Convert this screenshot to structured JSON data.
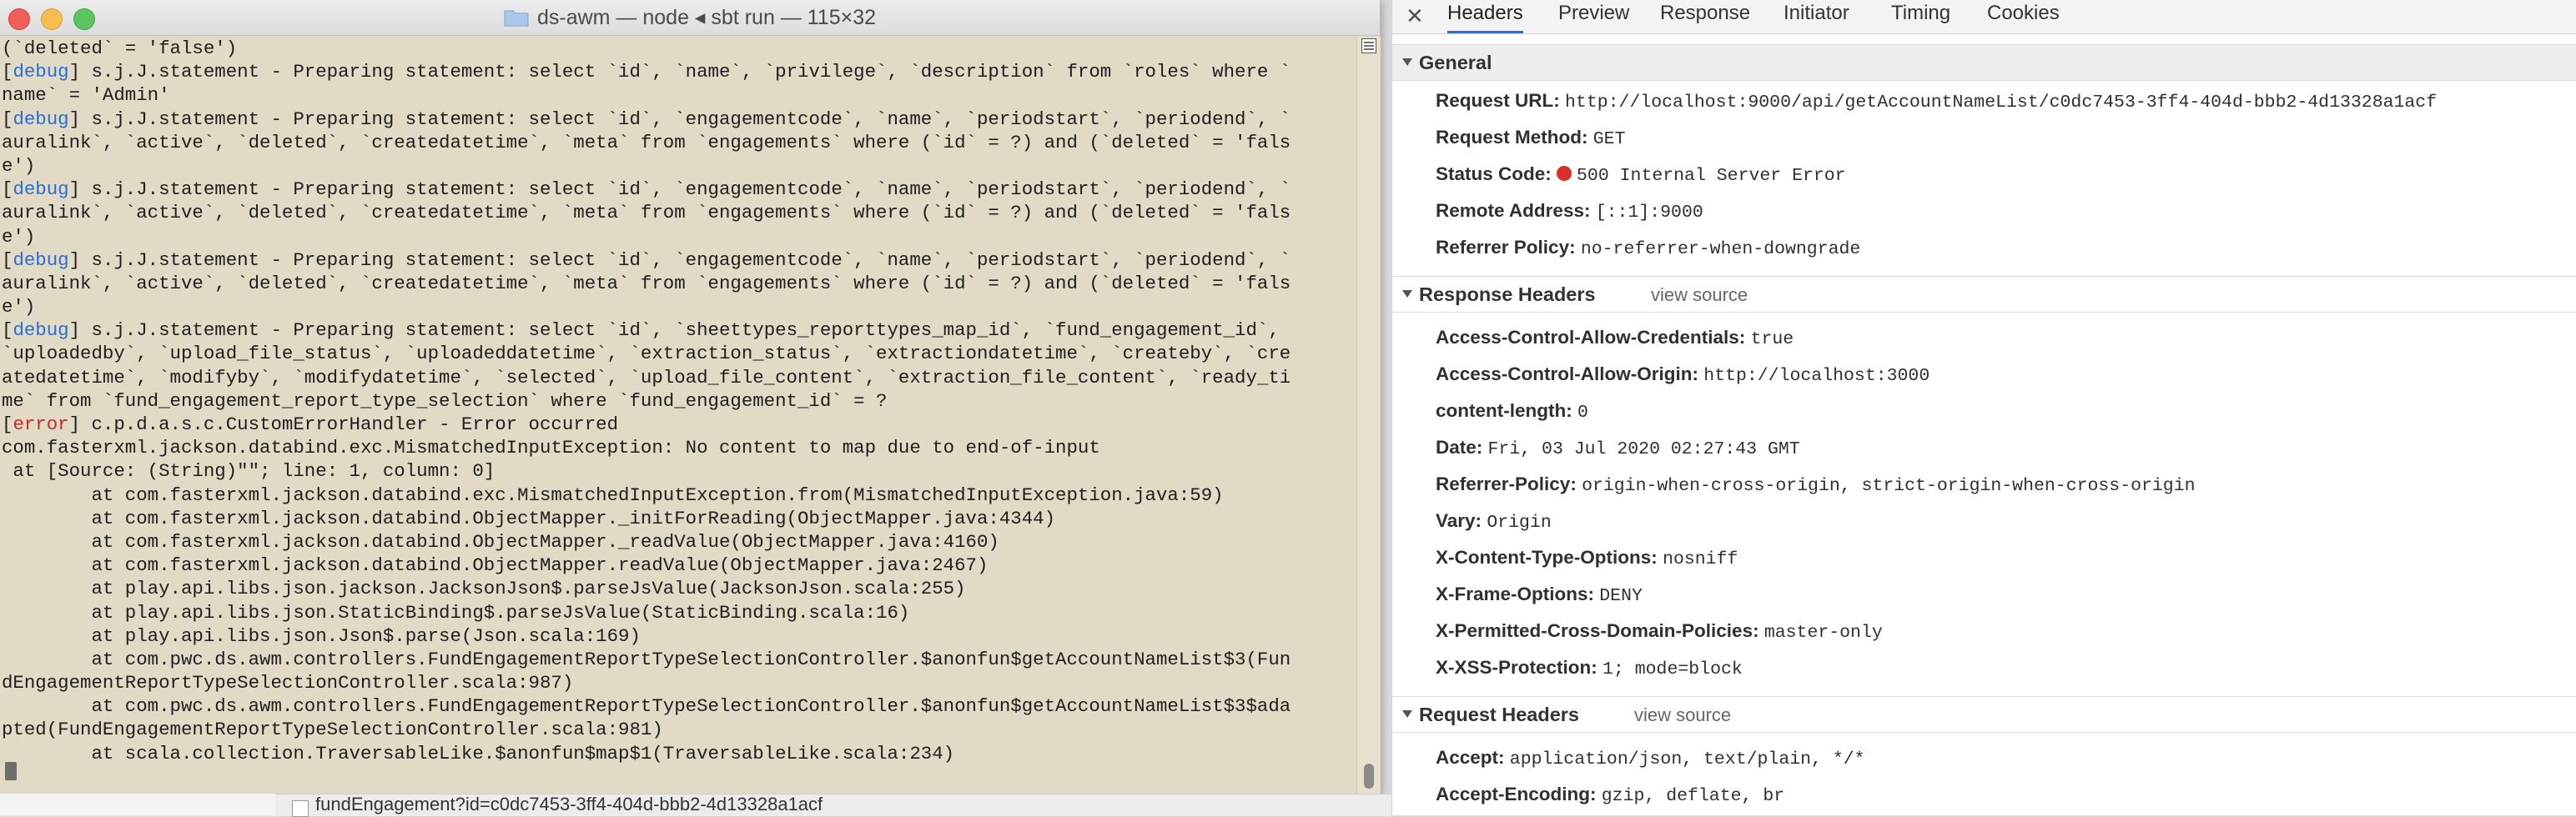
{
  "terminal": {
    "title": "ds-awm — node ◂ sbt run — 115×32",
    "lines": [
      {
        "tag": "",
        "text": "(`deleted` = 'false')"
      },
      {
        "tag": "debug",
        "text": " s.j.J.statement - Preparing statement: select `id`, `name`, `privilege`, `description` from `roles` where `"
      },
      {
        "tag": "",
        "text": "name` = 'Admin'"
      },
      {
        "tag": "debug",
        "text": " s.j.J.statement - Preparing statement: select `id`, `engagementcode`, `name`, `periodstart`, `periodend`, `"
      },
      {
        "tag": "",
        "text": "auralink`, `active`, `deleted`, `createdatetime`, `meta` from `engagements` where (`id` = ?) and (`deleted` = 'fals"
      },
      {
        "tag": "",
        "text": "e')"
      },
      {
        "tag": "debug",
        "text": " s.j.J.statement - Preparing statement: select `id`, `engagementcode`, `name`, `periodstart`, `periodend`, `"
      },
      {
        "tag": "",
        "text": "auralink`, `active`, `deleted`, `createdatetime`, `meta` from `engagements` where (`id` = ?) and (`deleted` = 'fals"
      },
      {
        "tag": "",
        "text": "e')"
      },
      {
        "tag": "debug",
        "text": " s.j.J.statement - Preparing statement: select `id`, `engagementcode`, `name`, `periodstart`, `periodend`, `"
      },
      {
        "tag": "",
        "text": "auralink`, `active`, `deleted`, `createdatetime`, `meta` from `engagements` where (`id` = ?) and (`deleted` = 'fals"
      },
      {
        "tag": "",
        "text": "e')"
      },
      {
        "tag": "debug",
        "text": " s.j.J.statement - Preparing statement: select `id`, `sheettypes_reporttypes_map_id`, `fund_engagement_id`, "
      },
      {
        "tag": "",
        "text": "`uploadedby`, `upload_file_status`, `uploadeddatetime`, `extraction_status`, `extractiondatetime`, `createby`, `cre"
      },
      {
        "tag": "",
        "text": "atedatetime`, `modifyby`, `modifydatetime`, `selected`, `upload_file_content`, `extraction_file_content`, `ready_ti"
      },
      {
        "tag": "",
        "text": "me` from `fund_engagement_report_type_selection` where `fund_engagement_id` = ?"
      },
      {
        "tag": "error",
        "text": " c.p.d.a.s.c.CustomErrorHandler - Error occurred"
      },
      {
        "tag": "",
        "text": "com.fasterxml.jackson.databind.exc.MismatchedInputException: No content to map due to end-of-input"
      },
      {
        "tag": "",
        "text": " at [Source: (String)\"\"; line: 1, column: 0]"
      },
      {
        "tag": "",
        "text": "        at com.fasterxml.jackson.databind.exc.MismatchedInputException.from(MismatchedInputException.java:59)"
      },
      {
        "tag": "",
        "text": "        at com.fasterxml.jackson.databind.ObjectMapper._initForReading(ObjectMapper.java:4344)"
      },
      {
        "tag": "",
        "text": "        at com.fasterxml.jackson.databind.ObjectMapper._readValue(ObjectMapper.java:4160)"
      },
      {
        "tag": "",
        "text": "        at com.fasterxml.jackson.databind.ObjectMapper.readValue(ObjectMapper.java:2467)"
      },
      {
        "tag": "",
        "text": "        at play.api.libs.json.jackson.JacksonJson$.parseJsValue(JacksonJson.scala:255)"
      },
      {
        "tag": "",
        "text": "        at play.api.libs.json.StaticBinding$.parseJsValue(StaticBinding.scala:16)"
      },
      {
        "tag": "",
        "text": "        at play.api.libs.json.Json$.parse(Json.scala:169)"
      },
      {
        "tag": "",
        "text": "        at com.pwc.ds.awm.controllers.FundEngagementReportTypeSelectionController.$anonfun$getAccountNameList$3(Fun"
      },
      {
        "tag": "",
        "text": "dEngagementReportTypeSelectionController.scala:987)"
      },
      {
        "tag": "",
        "text": "        at com.pwc.ds.awm.controllers.FundEngagementReportTypeSelectionController.$anonfun$getAccountNameList$3$ada"
      },
      {
        "tag": "",
        "text": "pted(FundEngagementReportTypeSelectionController.scala:981)"
      },
      {
        "tag": "",
        "text": "        at scala.collection.TraversableLike.$anonfun$map$1(TraversableLike.scala:234)"
      }
    ]
  },
  "underlying": {
    "row_text": "fundEngagement?id=c0dc7453-3ff4-404d-bbb2-4d13328a1acf"
  },
  "devtools": {
    "tabs": [
      "Headers",
      "Preview",
      "Response",
      "Initiator",
      "Timing",
      "Cookies"
    ],
    "active_tab": "Headers",
    "view_source_label": "view source",
    "general": {
      "title": "General",
      "rows": [
        {
          "key": "Request URL:",
          "value": "http://localhost:9000/api/getAccountNameList/c0dc7453-3ff4-404d-bbb2-4d13328a1acf"
        },
        {
          "key": "Request Method:",
          "value": "GET"
        },
        {
          "key": "Status Code:",
          "value": "500 Internal Server Error"
        },
        {
          "key": "Remote Address:",
          "value": "[::1]:9000"
        },
        {
          "key": "Referrer Policy:",
          "value": "no-referrer-when-downgrade"
        }
      ]
    },
    "response_headers": {
      "title": "Response Headers",
      "rows": [
        {
          "key": "Access-Control-Allow-Credentials:",
          "value": "true"
        },
        {
          "key": "Access-Control-Allow-Origin:",
          "value": "http://localhost:3000"
        },
        {
          "key": "content-length:",
          "value": "0"
        },
        {
          "key": "Date:",
          "value": "Fri, 03 Jul 2020 02:27:43 GMT"
        },
        {
          "key": "Referrer-Policy:",
          "value": "origin-when-cross-origin, strict-origin-when-cross-origin"
        },
        {
          "key": "Vary:",
          "value": "Origin"
        },
        {
          "key": "X-Content-Type-Options:",
          "value": "nosniff"
        },
        {
          "key": "X-Frame-Options:",
          "value": "DENY"
        },
        {
          "key": "X-Permitted-Cross-Domain-Policies:",
          "value": "master-only"
        },
        {
          "key": "X-XSS-Protection:",
          "value": "1; mode=block"
        }
      ]
    },
    "request_headers": {
      "title": "Request Headers",
      "rows": [
        {
          "key": "Accept:",
          "value": "application/json, text/plain, */*"
        },
        {
          "key": "Accept-Encoding:",
          "value": "gzip, deflate, br"
        }
      ]
    },
    "colors": {
      "accent": "#1a73e8",
      "error_dot": "#d93025",
      "debug_tag": "#2b6dd6",
      "error_tag": "#c62a2a"
    }
  }
}
